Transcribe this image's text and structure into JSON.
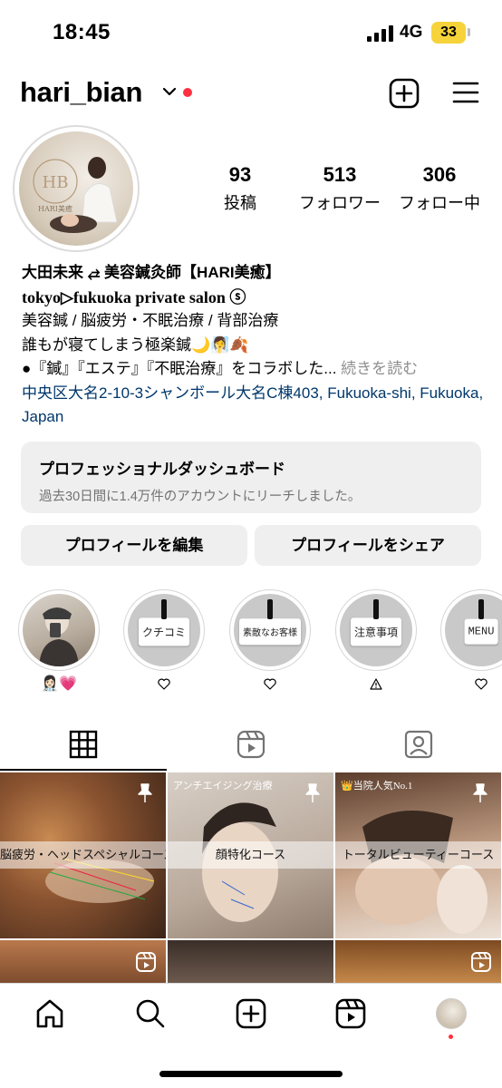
{
  "status_bar": {
    "time": "18:45",
    "network": "4G",
    "battery": "33"
  },
  "header": {
    "username": "hari_bian"
  },
  "stats": [
    {
      "value": "93",
      "label": "投稿"
    },
    {
      "value": "513",
      "label": "フォロワー"
    },
    {
      "value": "306",
      "label": "フォロー中"
    }
  ],
  "avatar": {
    "logo_text": "HARI美癒"
  },
  "bio": {
    "name": "大田未来 ⥄ 美容鍼灸師【HARI美癒】",
    "line1": "tokyo▷fukuoka private salon ⓢ",
    "line2": "美容鍼 / 脳疲労・不眠治療 / 背部治療",
    "line3": "誰もが寝てしまう極楽鍼🌙🧖‍♀️🍂",
    "line4": "●『鍼』『エステ』『不眠治療』をコラボした...",
    "more": "続きを読む",
    "address": "中央区大名2-10-3シャンボール大名C棟403, Fukuoka-shi, Fukuoka, Japan"
  },
  "dashboard": {
    "title": "プロフェッショナルダッシュボード",
    "subtitle": "過去30日間に1.4万件のアカウントにリーチしました。"
  },
  "buttons": {
    "edit": "プロフィールを編集",
    "share": "プロフィールをシェア"
  },
  "highlights": [
    {
      "card": "",
      "caption": "👩🏻‍⚕️💗",
      "icon": "photo"
    },
    {
      "card": "クチコミ",
      "caption": "",
      "icon": "heart-icon"
    },
    {
      "card": "素敵なお客様",
      "caption": "",
      "icon": "heart-icon"
    },
    {
      "card": "注意事項",
      "caption": "",
      "icon": "warning-icon"
    },
    {
      "card": "MENU",
      "caption": "",
      "icon": "heart-icon"
    }
  ],
  "tabs": [
    "grid-icon",
    "reels-icon",
    "tagged-icon"
  ],
  "posts": [
    {
      "label": "脳疲労・ヘッドスペシャルコース",
      "top_label": "",
      "pinned": true
    },
    {
      "label": "顔特化コース",
      "top_label": "アンチエイジング治療",
      "pinned": true
    },
    {
      "label": "トータルビューティーコース",
      "top_label": "👑当院人気No.1",
      "pinned": true
    }
  ],
  "colors": {
    "accent_red": "#ff3040",
    "link_blue": "#00376b",
    "muted": "#737373",
    "button_bg": "#efefef",
    "battery": "#f6d33b"
  }
}
